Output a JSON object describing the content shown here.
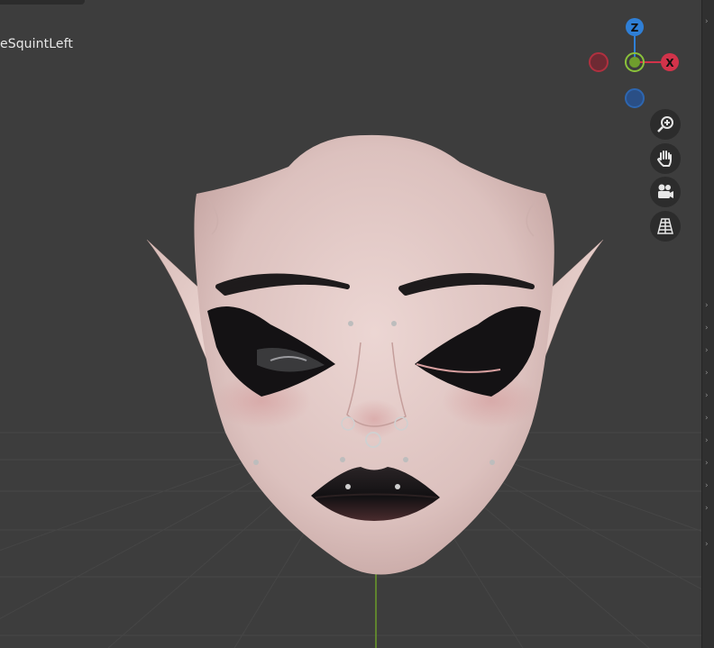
{
  "viewport": {
    "object_label": "eSquintLeft",
    "background": "#3d3d3d",
    "grid_line_color": "#4a4a4a",
    "z_axis_color": "#6b9b2a"
  },
  "gizmo": {
    "z": {
      "label": "Z",
      "color": "#2f7fd6"
    },
    "x": {
      "label": "X",
      "color": "#d2334a"
    },
    "y_positive_color": "#8ac23a",
    "x_negative_color": "#b0303f",
    "z_negative_color": "#2d66b0"
  },
  "nav_tools": [
    {
      "name": "zoom-icon",
      "icon": "magnifier-plus"
    },
    {
      "name": "pan-icon",
      "icon": "hand"
    },
    {
      "name": "camera-icon",
      "icon": "camera"
    },
    {
      "name": "perspective-icon",
      "icon": "grid"
    }
  ],
  "model": {
    "skin_color": "#e3c8c5",
    "lip_color": "#1b1a1c",
    "makeup_color": "#141214"
  }
}
